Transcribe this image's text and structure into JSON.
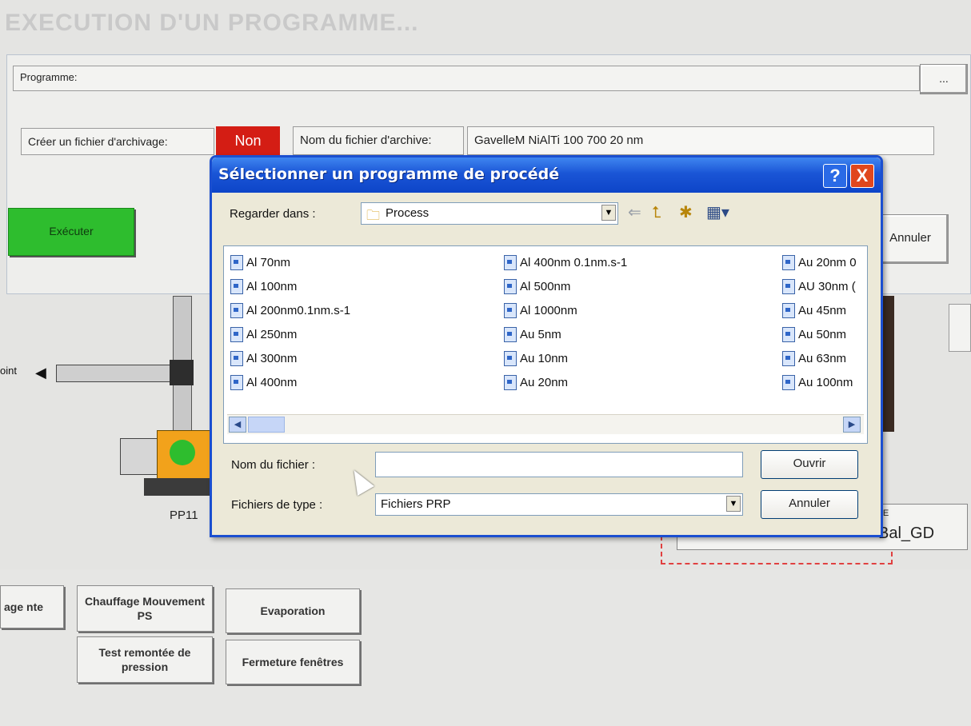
{
  "app": {
    "title": "EXECUTION D'UN PROGRAMME...",
    "programme_label": "Programme:",
    "browse_label": "...",
    "archive_label": "Créer un fichier d'archivage:",
    "archive_toggle": "Non",
    "archive_name_label": "Nom du fichier d'archive:",
    "archive_name_value": "GavelleM NiAlTi 100 700 20 nm",
    "execute_label": "Exécuter",
    "cancel_label": "Annuler",
    "pump_label": "PP11",
    "left_label": "oint",
    "right_panel_title": "AGE",
    "right_panel_value": "Bal_GD"
  },
  "bottom_buttons": {
    "b1": "age nte",
    "b2": "Chauffage Mouvement PS",
    "b3": "Evaporation",
    "b4": "Test remontée de pression",
    "b5": "Fermeture fenêtres"
  },
  "dialog": {
    "title": "Sélectionner un programme de procédé",
    "help_btn": "?",
    "close_btn": "X",
    "look_in_label": "Regarder dans :",
    "look_in_value": "Process",
    "filename_label": "Nom du fichier :",
    "filename_value": "",
    "filetype_label": "Fichiers de type :",
    "filetype_value": "Fichiers PRP",
    "open_btn": "Ouvrir",
    "cancel_btn": "Annuler",
    "files_col1": [
      "Al 70nm",
      "Al 100nm",
      "Al 200nm0.1nm.s-1",
      "Al 250nm",
      "Al 300nm",
      "Al 400nm"
    ],
    "files_col2": [
      "Al 400nm 0.1nm.s-1",
      "Al 500nm",
      "Al 1000nm",
      "Au 5nm",
      "Au 10nm",
      "Au 20nm"
    ],
    "files_col3": [
      "Au 20nm 0",
      "AU 30nm (",
      "Au 45nm",
      "Au 50nm",
      "Au 63nm",
      "Au 100nm"
    ]
  },
  "colors": {
    "accent_green": "#2ebd2e",
    "toggle_red": "#d41d14",
    "dialog_blue": "#1a55d6"
  }
}
